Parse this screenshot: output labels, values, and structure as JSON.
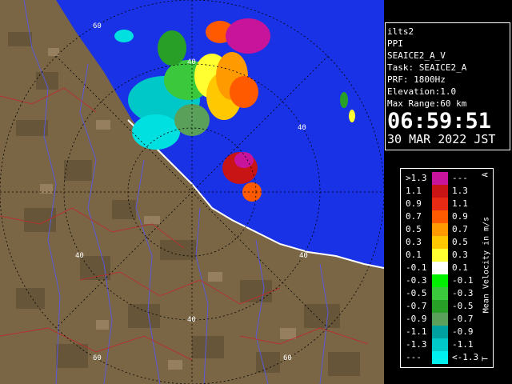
{
  "info": {
    "site": "ilts2",
    "mode": "PPI",
    "product": "SEAICE2_A_V",
    "task": "Task: SEAICE2_A",
    "prf": "PRF: 1800Hz",
    "elevation": "Elevation:1.0",
    "max_range": "Max Range:60 km",
    "time": "06:59:51",
    "date": "30 MAR 2022 JST"
  },
  "radar": {
    "range_ring_labels": [
      "60",
      "40",
      "40",
      "40",
      "40",
      "40",
      "60",
      "60"
    ],
    "colors": {
      "sea": "#1a32e6",
      "land": "#7a6644",
      "coast": "#ffffff",
      "rivers": "#5a5adc",
      "borders": "#b43232"
    }
  },
  "legend": {
    "unit": "Mean Velocity in m/s",
    "top_symbol": "A",
    "bottom_symbol": "T",
    "rows": [
      {
        "min": ">1.3",
        "max": "---",
        "color": "#c8149a"
      },
      {
        "min": "1.1",
        "max": "1.3",
        "color": "#c81414"
      },
      {
        "min": "0.9",
        "max": "1.1",
        "color": "#e62a14"
      },
      {
        "min": "0.7",
        "max": "0.9",
        "color": "#ff5a00"
      },
      {
        "min": "0.5",
        "max": "0.7",
        "color": "#ff9a00"
      },
      {
        "min": "0.3",
        "max": "0.5",
        "color": "#ffc800"
      },
      {
        "min": "0.1",
        "max": "0.3",
        "color": "#ffff32"
      },
      {
        "min": "-0.1",
        "max": "0.1",
        "color": "#ffffff"
      },
      {
        "min": "-0.3",
        "max": "-0.1",
        "color": "#00f000"
      },
      {
        "min": "-0.5",
        "max": "-0.3",
        "color": "#3cc83c"
      },
      {
        "min": "-0.7",
        "max": "-0.5",
        "color": "#28a028"
      },
      {
        "min": "-0.9",
        "max": "-0.7",
        "color": "#5aa05a"
      },
      {
        "min": "-1.1",
        "max": "-0.9",
        "color": "#00a0a0"
      },
      {
        "min": "-1.3",
        "max": "-1.1",
        "color": "#00c8c8"
      },
      {
        "min": "---",
        "max": "<-1.3",
        "color": "#00f0f0"
      }
    ]
  }
}
